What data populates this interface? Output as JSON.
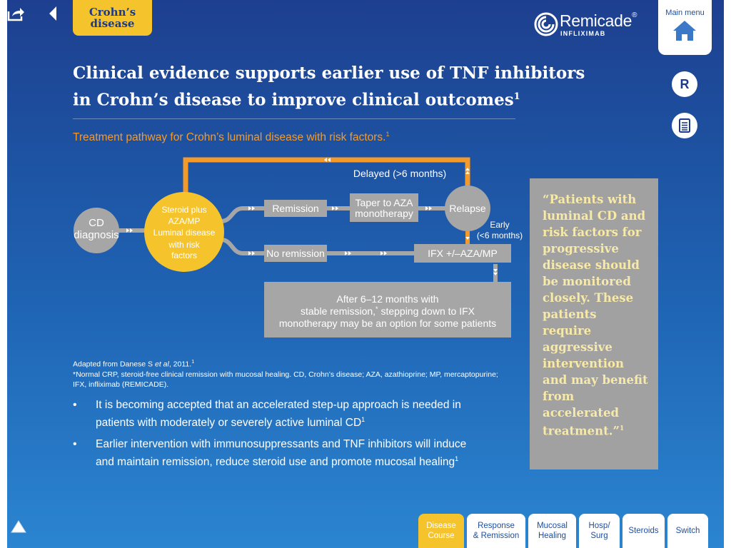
{
  "section_tab": {
    "line1": "Crohn’s",
    "line2": "disease"
  },
  "brand": {
    "name": "Remicade",
    "reg": "®",
    "sub": "INFLIXIMAB"
  },
  "main_menu": {
    "label": "Main menu"
  },
  "r_button": {
    "label": "R"
  },
  "headline": {
    "line1": "Clinical evidence supports earlier use of TNF inhibitors",
    "line2": "in Crohn’s disease to improve clinical outcomes",
    "sup": "1"
  },
  "subheading": {
    "text": "Treatment pathway for Crohn’s luminal disease with risk factors.",
    "sup": "1"
  },
  "diagram": {
    "cd_line1": "CD",
    "cd_line2": "diagnosis",
    "steroid_lines": [
      "Steroid plus",
      "AZA/MP",
      "Luminal disease",
      "with risk",
      "factors"
    ],
    "remission": "Remission",
    "taper_line1": "Taper to AZA",
    "taper_line2": "monotherapy",
    "relapse": "Relapse",
    "delayed": "Delayed (>6 months)",
    "early_line1": "Early",
    "early_line2": "(<6 months)",
    "no_remission": "No remission",
    "ifx": "IFX +/–AZA/MP",
    "after_line1": "After 6–12 months with",
    "after_line2_a": "stable remission,",
    "after_line2_sup": "*",
    "after_line2_b": " stepping down to IFX",
    "after_line3": "monotherapy may be an option for some patients"
  },
  "source": {
    "adapted_a": "Adapted from Danese S ",
    "adapted_etal": "et al",
    "adapted_b": ", 2011.",
    "adapted_sup": "1",
    "note1": "*Normal CRP, steroid-free clinical remission with mucosal healing. CD, Crohn’s disease; AZA, azathioprine; MP, mercaptopurine;",
    "note2": "IFX, infliximab (REMICADE)."
  },
  "bullets": [
    {
      "line1": "It is becoming accepted that an accelerated step-up approach is needed in",
      "line2": "patients with moderately or severely active luminal CD",
      "sup": "1"
    },
    {
      "line1": "Earlier intervention with immunosuppressants and TNF inhibitors will induce",
      "line2": "and maintain remission, reduce steroid use and promote mucosal healing",
      "sup": "1"
    }
  ],
  "bullet_symbol": "•",
  "quote": {
    "text": "“Patients with luminal CD and risk factors for progressive disease should be monitored closely. These patients require aggressive intervention and may benefit from accelerated treatment.”",
    "sup": "1"
  },
  "bottom_tabs": [
    {
      "label": "Disease\nCourse",
      "active": true
    },
    {
      "label": "Response\n& Remission",
      "active": false
    },
    {
      "label": "Mucosal\nHealing",
      "active": false
    },
    {
      "label": "Hosp/\nSurg",
      "active": false
    },
    {
      "label": "Steroids",
      "active": false
    },
    {
      "label": "Switch",
      "active": false
    }
  ],
  "colors": {
    "accent_yellow": "#f5c42c",
    "accent_orange": "#f39a2b",
    "box_grey": "#a6a6a6",
    "quote_text": "#f7e9a8"
  }
}
